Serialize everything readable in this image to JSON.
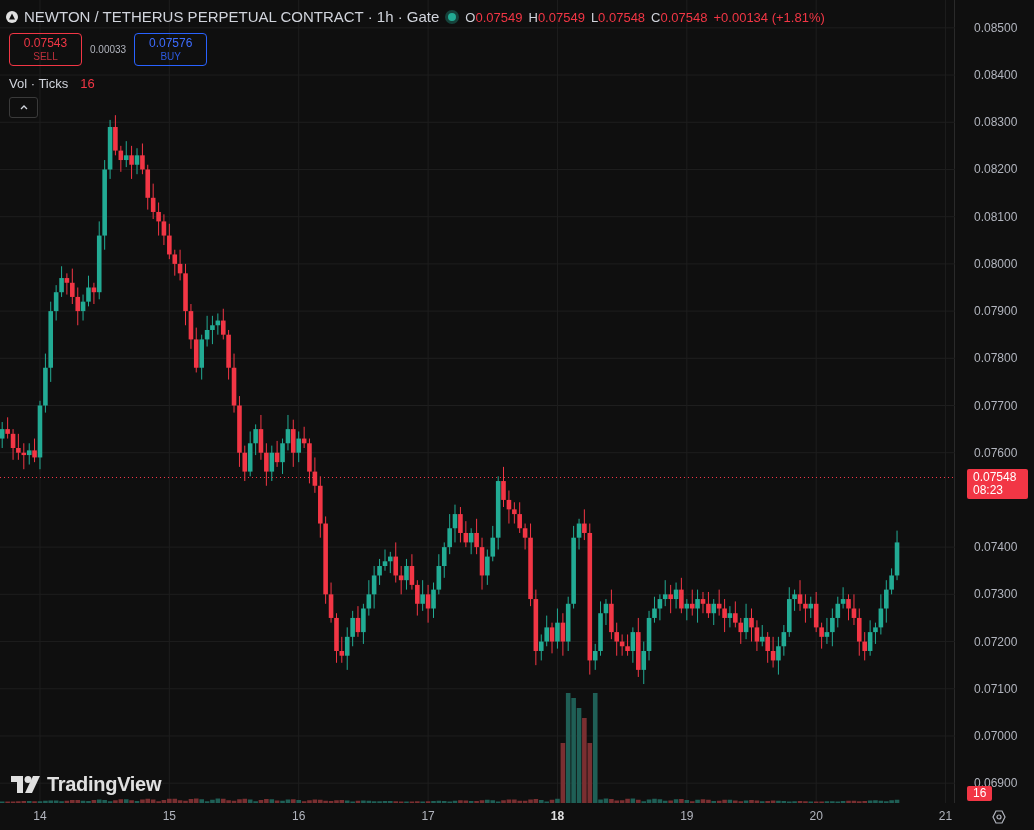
{
  "legend": {
    "symbol": "NEWTON / TETHERUS PERPETUAL CONTRACT · 1h · Gate",
    "market_open": true,
    "ohlc": [
      {
        "label": "O",
        "value": "0.07549"
      },
      {
        "label": "H",
        "value": "0.07549"
      },
      {
        "label": "L",
        "value": "0.07548"
      },
      {
        "label": "C",
        "value": "0.07548"
      }
    ],
    "change": "+0.00134 (+1.81%)"
  },
  "trade": {
    "sell": {
      "price": "0.07543",
      "label": "SELL"
    },
    "spread": "0.00033",
    "buy": {
      "price": "0.07576",
      "label": "BUY"
    }
  },
  "volume_legend": {
    "label": "Vol · Ticks",
    "value": "16"
  },
  "price_axis": {
    "last_price": "0.07548",
    "countdown": "08:23",
    "volume_marker": "16"
  },
  "branding": {
    "name": "TradingView"
  },
  "time_axis": {
    "ticks": [
      {
        "emphasized": false
      },
      {
        "emphasized": false
      },
      {
        "emphasized": false
      },
      {
        "emphasized": false
      },
      {
        "emphasized": true
      },
      {
        "emphasized": false
      },
      {
        "emphasized": false
      },
      {
        "emphasized": false
      }
    ]
  },
  "chart": {
    "chart_data": {
      "type": "candlestick",
      "grid": true,
      "ref_lines": [
        {
          "axis": "y",
          "value": 0.07548
        }
      ],
      "ylim": [
        0.06858,
        0.08559
      ],
      "xlim": [
        13.691,
        21.073
      ],
      "yticks": [
        {
          "value": 0.085,
          "label": "0.08500"
        },
        {
          "value": 0.084,
          "label": "0.08400"
        },
        {
          "value": 0.083,
          "label": "0.08300"
        },
        {
          "value": 0.082,
          "label": "0.08200"
        },
        {
          "value": 0.081,
          "label": "0.08100"
        },
        {
          "value": 0.08,
          "label": "0.08000"
        },
        {
          "value": 0.079,
          "label": "0.07900"
        },
        {
          "value": 0.078,
          "label": "0.07800"
        },
        {
          "value": 0.077,
          "label": "0.07700"
        },
        {
          "value": 0.076,
          "label": "0.07600"
        },
        {
          "value": 0.074,
          "label": "0.07400"
        },
        {
          "value": 0.073,
          "label": "0.07300"
        },
        {
          "value": 0.072,
          "label": "0.07200"
        },
        {
          "value": 0.071,
          "label": "0.07100"
        },
        {
          "value": 0.07,
          "label": "0.07000"
        },
        {
          "value": 0.069,
          "label": "0.06900"
        }
      ],
      "xticks": [
        14,
        15,
        16,
        17,
        18,
        19,
        20,
        21
      ],
      "x": [
        13.708,
        13.75,
        13.792,
        13.833,
        13.875,
        13.917,
        13.958,
        14,
        14.042,
        14.083,
        14.125,
        14.167,
        14.208,
        14.25,
        14.292,
        14.333,
        14.375,
        14.417,
        14.458,
        14.5,
        14.542,
        14.583,
        14.625,
        14.667,
        14.708,
        14.75,
        14.792,
        14.833,
        14.875,
        14.917,
        14.958,
        15,
        15.042,
        15.083,
        15.125,
        15.167,
        15.208,
        15.25,
        15.292,
        15.333,
        15.375,
        15.417,
        15.458,
        15.5,
        15.542,
        15.583,
        15.625,
        15.667,
        15.708,
        15.75,
        15.792,
        15.833,
        15.875,
        15.917,
        15.958,
        16,
        16.042,
        16.083,
        16.125,
        16.167,
        16.208,
        16.25,
        16.292,
        16.333,
        16.375,
        16.417,
        16.458,
        16.5,
        16.542,
        16.583,
        16.625,
        16.667,
        16.708,
        16.75,
        16.792,
        16.833,
        16.875,
        16.917,
        16.958,
        17,
        17.042,
        17.083,
        17.125,
        17.167,
        17.208,
        17.25,
        17.292,
        17.333,
        17.375,
        17.417,
        17.458,
        17.5,
        17.542,
        17.583,
        17.625,
        17.667,
        17.708,
        17.75,
        17.792,
        17.833,
        17.875,
        17.917,
        17.958,
        18,
        18.042,
        18.083,
        18.125,
        18.167,
        18.208,
        18.25,
        18.292,
        18.333,
        18.375,
        18.417,
        18.458,
        18.5,
        18.542,
        18.583,
        18.625,
        18.667,
        18.708,
        18.75,
        18.792,
        18.833,
        18.875,
        18.917,
        18.958,
        19,
        19.042,
        19.083,
        19.125,
        19.167,
        19.208,
        19.25,
        19.292,
        19.333,
        19.375,
        19.417,
        19.458,
        19.5,
        19.542,
        19.583,
        19.625,
        19.667,
        19.708,
        19.75,
        19.792,
        19.833,
        19.875,
        19.917,
        19.958,
        20,
        20.042,
        20.083,
        20.125,
        20.167,
        20.208,
        20.25,
        20.292,
        20.333,
        20.375,
        20.417,
        20.458,
        20.5,
        20.542,
        20.583,
        20.625
      ],
      "ohlc": [
        [
          0.0763,
          0.07665,
          0.0761,
          0.0765
        ],
        [
          0.0765,
          0.07675,
          0.0763,
          0.0764
        ],
        [
          0.0764,
          0.0765,
          0.07585,
          0.0761
        ],
        [
          0.0761,
          0.0764,
          0.07585,
          0.076
        ],
        [
          0.076,
          0.0762,
          0.07565,
          0.07595
        ],
        [
          0.07595,
          0.0762,
          0.07575,
          0.07605
        ],
        [
          0.07605,
          0.0763,
          0.0758,
          0.0759
        ],
        [
          0.0759,
          0.0771,
          0.07565,
          0.077
        ],
        [
          0.077,
          0.0781,
          0.07685,
          0.0778
        ],
        [
          0.0778,
          0.0792,
          0.0775,
          0.079
        ],
        [
          0.079,
          0.07955,
          0.0788,
          0.0794
        ],
        [
          0.0794,
          0.07995,
          0.0793,
          0.0797
        ],
        [
          0.0797,
          0.0798,
          0.07935,
          0.0796
        ],
        [
          0.0796,
          0.0799,
          0.07915,
          0.0793
        ],
        [
          0.0793,
          0.0795,
          0.0787,
          0.079
        ],
        [
          0.079,
          0.07935,
          0.0788,
          0.0792
        ],
        [
          0.0792,
          0.07975,
          0.0791,
          0.0795
        ],
        [
          0.0795,
          0.0796,
          0.07915,
          0.0794
        ],
        [
          0.0794,
          0.0809,
          0.07925,
          0.0806
        ],
        [
          0.0806,
          0.0822,
          0.0803,
          0.082
        ],
        [
          0.082,
          0.08305,
          0.0818,
          0.0829
        ],
        [
          0.0829,
          0.08315,
          0.0823,
          0.0824
        ],
        [
          0.0824,
          0.0825,
          0.08195,
          0.0822
        ],
        [
          0.0822,
          0.0826,
          0.08205,
          0.0823
        ],
        [
          0.0823,
          0.0825,
          0.0818,
          0.0821
        ],
        [
          0.0821,
          0.08245,
          0.0819,
          0.0823
        ],
        [
          0.0823,
          0.08255,
          0.0819,
          0.082
        ],
        [
          0.082,
          0.0821,
          0.08115,
          0.0814
        ],
        [
          0.0814,
          0.0817,
          0.08095,
          0.0811
        ],
        [
          0.0811,
          0.0813,
          0.0806,
          0.0809
        ],
        [
          0.0809,
          0.08105,
          0.0804,
          0.0806
        ],
        [
          0.0806,
          0.08085,
          0.0801,
          0.0802
        ],
        [
          0.0802,
          0.0803,
          0.07975,
          0.08
        ],
        [
          0.08,
          0.0803,
          0.07965,
          0.0798
        ],
        [
          0.0798,
          0.08,
          0.0787,
          0.079
        ],
        [
          0.079,
          0.07915,
          0.0782,
          0.0784
        ],
        [
          0.0784,
          0.07865,
          0.0777,
          0.0778
        ],
        [
          0.0778,
          0.0785,
          0.07755,
          0.0784
        ],
        [
          0.0784,
          0.0789,
          0.07825,
          0.0786
        ],
        [
          0.0786,
          0.0789,
          0.0783,
          0.0787
        ],
        [
          0.0787,
          0.07895,
          0.0785,
          0.0788
        ],
        [
          0.0788,
          0.07905,
          0.0784,
          0.0785
        ],
        [
          0.0785,
          0.0786,
          0.07755,
          0.0778
        ],
        [
          0.0778,
          0.0781,
          0.07685,
          0.077
        ],
        [
          0.077,
          0.0772,
          0.0757,
          0.076
        ],
        [
          0.076,
          0.07615,
          0.0754,
          0.0756
        ],
        [
          0.0756,
          0.07645,
          0.0755,
          0.0762
        ],
        [
          0.0762,
          0.0766,
          0.07595,
          0.0765
        ],
        [
          0.0765,
          0.0768,
          0.07585,
          0.076
        ],
        [
          0.076,
          0.0762,
          0.0753,
          0.0756
        ],
        [
          0.0756,
          0.07615,
          0.0754,
          0.076
        ],
        [
          0.076,
          0.07625,
          0.0757,
          0.0758
        ],
        [
          0.0758,
          0.0763,
          0.07555,
          0.0762
        ],
        [
          0.0762,
          0.0768,
          0.07605,
          0.0765
        ],
        [
          0.0765,
          0.0767,
          0.0757,
          0.076
        ],
        [
          0.076,
          0.07645,
          0.0758,
          0.0763
        ],
        [
          0.0763,
          0.07655,
          0.0761,
          0.0762
        ],
        [
          0.0762,
          0.0763,
          0.07535,
          0.0756
        ],
        [
          0.0756,
          0.0759,
          0.07515,
          0.0753
        ],
        [
          0.0753,
          0.0755,
          0.0742,
          0.0745
        ],
        [
          0.0745,
          0.07465,
          0.0728,
          0.073
        ],
        [
          0.073,
          0.07325,
          0.0724,
          0.0725
        ],
        [
          0.0725,
          0.0726,
          0.07155,
          0.0718
        ],
        [
          0.0718,
          0.0721,
          0.07155,
          0.0717
        ],
        [
          0.0717,
          0.0723,
          0.0714,
          0.0721
        ],
        [
          0.0721,
          0.07265,
          0.0719,
          0.0725
        ],
        [
          0.0725,
          0.07275,
          0.0721,
          0.0722
        ],
        [
          0.0722,
          0.0728,
          0.07195,
          0.0727
        ],
        [
          0.0727,
          0.0733,
          0.07255,
          0.073
        ],
        [
          0.073,
          0.0736,
          0.0727,
          0.0734
        ],
        [
          0.0734,
          0.07375,
          0.0732,
          0.0736
        ],
        [
          0.0736,
          0.07395,
          0.0735,
          0.0737
        ],
        [
          0.0737,
          0.0739,
          0.07345,
          0.0738
        ],
        [
          0.0738,
          0.0741,
          0.07325,
          0.0734
        ],
        [
          0.0734,
          0.0736,
          0.073,
          0.0733
        ],
        [
          0.0733,
          0.07375,
          0.0731,
          0.0736
        ],
        [
          0.0736,
          0.07385,
          0.0731,
          0.0732
        ],
        [
          0.0732,
          0.0733,
          0.07255,
          0.0728
        ],
        [
          0.0728,
          0.0733,
          0.07265,
          0.073
        ],
        [
          0.073,
          0.0732,
          0.0724,
          0.0727
        ],
        [
          0.0727,
          0.07325,
          0.0725,
          0.0731
        ],
        [
          0.0731,
          0.07385,
          0.073,
          0.0736
        ],
        [
          0.0736,
          0.0741,
          0.07335,
          0.074
        ],
        [
          0.074,
          0.0747,
          0.07385,
          0.0744
        ],
        [
          0.0744,
          0.0749,
          0.0741,
          0.0747
        ],
        [
          0.0747,
          0.07485,
          0.0741,
          0.0743
        ],
        [
          0.0743,
          0.07455,
          0.074,
          0.0741
        ],
        [
          0.0741,
          0.0744,
          0.07385,
          0.0743
        ],
        [
          0.0743,
          0.0746,
          0.07385,
          0.074
        ],
        [
          0.074,
          0.0742,
          0.0731,
          0.0734
        ],
        [
          0.0734,
          0.07395,
          0.0732,
          0.0738
        ],
        [
          0.0738,
          0.07445,
          0.0737,
          0.0742
        ],
        [
          0.0742,
          0.0755,
          0.07395,
          0.0754
        ],
        [
          0.0754,
          0.0757,
          0.07485,
          0.075
        ],
        [
          0.075,
          0.0752,
          0.0745,
          0.0748
        ],
        [
          0.0748,
          0.07495,
          0.0745,
          0.0747
        ],
        [
          0.0747,
          0.07495,
          0.0743,
          0.0744
        ],
        [
          0.0744,
          0.0745,
          0.07395,
          0.0742
        ],
        [
          0.0742,
          0.0745,
          0.07275,
          0.0729
        ],
        [
          0.0729,
          0.0731,
          0.0715,
          0.0718
        ],
        [
          0.0718,
          0.07215,
          0.0716,
          0.072
        ],
        [
          0.072,
          0.07255,
          0.0719,
          0.0723
        ],
        [
          0.0723,
          0.0724,
          0.07175,
          0.072
        ],
        [
          0.072,
          0.0727,
          0.07185,
          0.0724
        ],
        [
          0.0724,
          0.0726,
          0.0717,
          0.072
        ],
        [
          0.072,
          0.07295,
          0.0718,
          0.0728
        ],
        [
          0.0728,
          0.07445,
          0.0727,
          0.0742
        ],
        [
          0.0742,
          0.0746,
          0.07395,
          0.0745
        ],
        [
          0.0745,
          0.0748,
          0.07415,
          0.0743
        ],
        [
          0.0743,
          0.0745,
          0.0713,
          0.0716
        ],
        [
          0.0716,
          0.07195,
          0.0714,
          0.0718
        ],
        [
          0.0718,
          0.07285,
          0.0717,
          0.0726
        ],
        [
          0.0726,
          0.0729,
          0.07235,
          0.0728
        ],
        [
          0.0728,
          0.0731,
          0.07205,
          0.0722
        ],
        [
          0.0722,
          0.0724,
          0.0717,
          0.072
        ],
        [
          0.072,
          0.07215,
          0.0717,
          0.0719
        ],
        [
          0.0719,
          0.07215,
          0.0717,
          0.0718
        ],
        [
          0.0718,
          0.0723,
          0.07155,
          0.0722
        ],
        [
          0.0722,
          0.0725,
          0.07125,
          0.0714
        ],
        [
          0.0714,
          0.072,
          0.0711,
          0.0718
        ],
        [
          0.0718,
          0.07265,
          0.0716,
          0.0725
        ],
        [
          0.0725,
          0.07295,
          0.0724,
          0.0727
        ],
        [
          0.0727,
          0.073,
          0.07245,
          0.0729
        ],
        [
          0.0729,
          0.0733,
          0.07275,
          0.073
        ],
        [
          0.073,
          0.0732,
          0.0726,
          0.0729
        ],
        [
          0.0729,
          0.07325,
          0.0727,
          0.0731
        ],
        [
          0.0731,
          0.07335,
          0.0726,
          0.0727
        ],
        [
          0.0727,
          0.0729,
          0.07245,
          0.0728
        ],
        [
          0.0728,
          0.0731,
          0.07255,
          0.0727
        ],
        [
          0.0727,
          0.0731,
          0.0724,
          0.0729
        ],
        [
          0.0729,
          0.07305,
          0.0726,
          0.0728
        ],
        [
          0.0728,
          0.07305,
          0.0725,
          0.0726
        ],
        [
          0.0726,
          0.0729,
          0.07235,
          0.0728
        ],
        [
          0.0728,
          0.0731,
          0.07255,
          0.0727
        ],
        [
          0.0727,
          0.0729,
          0.0722,
          0.0725
        ],
        [
          0.0725,
          0.07275,
          0.0723,
          0.0726
        ],
        [
          0.0726,
          0.07285,
          0.0723,
          0.0724
        ],
        [
          0.0724,
          0.0725,
          0.07195,
          0.0722
        ],
        [
          0.0722,
          0.0728,
          0.07205,
          0.0725
        ],
        [
          0.0725,
          0.0727,
          0.072,
          0.0723
        ],
        [
          0.0723,
          0.07245,
          0.0718,
          0.072
        ],
        [
          0.072,
          0.07235,
          0.0719,
          0.0721
        ],
        [
          0.0721,
          0.0722,
          0.07155,
          0.0718
        ],
        [
          0.0718,
          0.0721,
          0.07145,
          0.0716
        ],
        [
          0.0716,
          0.0721,
          0.0713,
          0.0719
        ],
        [
          0.0719,
          0.07235,
          0.0717,
          0.0722
        ],
        [
          0.0722,
          0.07315,
          0.0721,
          0.0729
        ],
        [
          0.0729,
          0.0731,
          0.07265,
          0.073
        ],
        [
          0.073,
          0.0733,
          0.07265,
          0.0728
        ],
        [
          0.0728,
          0.073,
          0.0724,
          0.0727
        ],
        [
          0.0727,
          0.07295,
          0.0725,
          0.0728
        ],
        [
          0.0728,
          0.07305,
          0.0722,
          0.0723
        ],
        [
          0.0723,
          0.0724,
          0.07185,
          0.0721
        ],
        [
          0.0721,
          0.0725,
          0.07195,
          0.0722
        ],
        [
          0.0722,
          0.0727,
          0.0719,
          0.0725
        ],
        [
          0.0725,
          0.07295,
          0.0723,
          0.0728
        ],
        [
          0.0728,
          0.07315,
          0.0727,
          0.0729
        ],
        [
          0.0729,
          0.073,
          0.07245,
          0.0727
        ],
        [
          0.0727,
          0.073,
          0.07235,
          0.0725
        ],
        [
          0.0725,
          0.0727,
          0.0717,
          0.072
        ],
        [
          0.072,
          0.0722,
          0.0716,
          0.0718
        ],
        [
          0.0718,
          0.07245,
          0.0717,
          0.0722
        ],
        [
          0.0722,
          0.0724,
          0.07195,
          0.0723
        ],
        [
          0.0723,
          0.073,
          0.07215,
          0.0727
        ],
        [
          0.0727,
          0.0733,
          0.0724,
          0.0731
        ],
        [
          0.0731,
          0.07355,
          0.073,
          0.0734
        ],
        [
          0.0734,
          0.07435,
          0.0733,
          0.0741
        ]
      ]
    }
  }
}
